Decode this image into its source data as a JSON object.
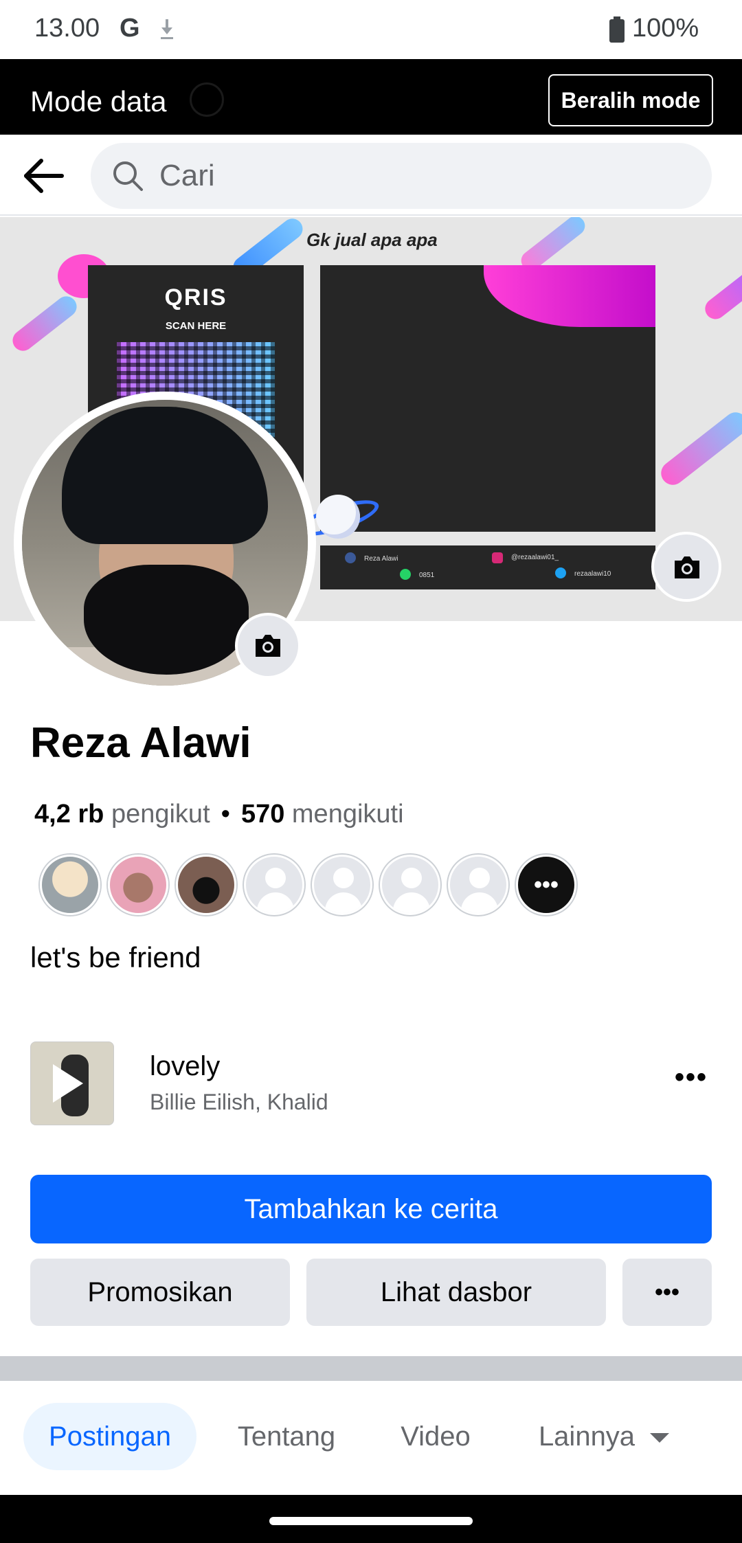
{
  "status_bar": {
    "time": "13.00",
    "g_letter": "G",
    "battery_percent": "100%"
  },
  "data_mode": {
    "title": "Mode data",
    "switch_label": "Beralih mode"
  },
  "search": {
    "placeholder": "Cari"
  },
  "cover": {
    "caption": "Gk jual apa apa",
    "qr_logo": "QRIS",
    "qr_scan": "SCAN HERE",
    "strip": {
      "facebook": "Reza Alawi",
      "instagram": "@rezaalawi01_",
      "whatsapp": "0851",
      "twitter": "rezaalawi10"
    }
  },
  "profile": {
    "name": "Reza Alawi",
    "followers_count": "4,2 rb",
    "followers_label": "pengikut",
    "separator": "•",
    "following_count": "570",
    "following_label": "mengikuti",
    "bio": "let's be friend",
    "friends_more": "•••"
  },
  "music": {
    "title": "lovely",
    "artist": "Billie Eilish, Khalid",
    "more": "•••"
  },
  "actions": {
    "add_story": "Tambahkan ke cerita",
    "promote": "Promosikan",
    "dashboard": "Lihat dasbor",
    "more": "•••"
  },
  "tabs": [
    {
      "label": "Postingan",
      "active": true
    },
    {
      "label": "Tentang",
      "active": false
    },
    {
      "label": "Video",
      "active": false
    },
    {
      "label": "Lainnya",
      "active": false
    }
  ],
  "colors": {
    "accent": "#0866ff",
    "tab_active_bg": "#ebf5ff",
    "button_grey": "#e4e6eb",
    "divider": "#c9ccd1"
  }
}
